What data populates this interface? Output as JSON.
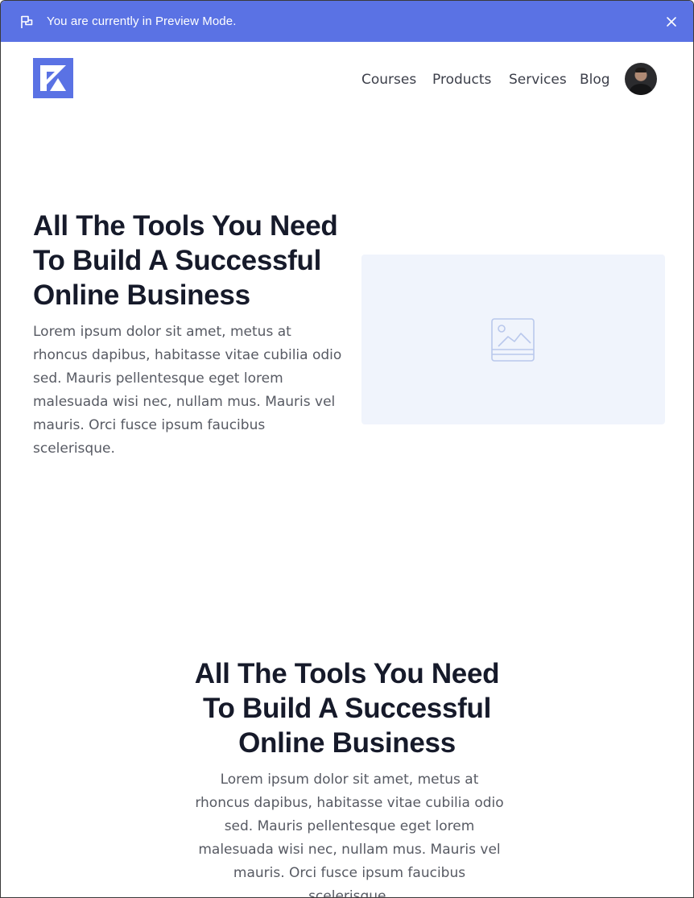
{
  "preview_banner": {
    "text": "You are currently in Preview Mode.",
    "flag_icon": "flag-icon",
    "close_icon": "close-icon",
    "color": "#5a72e4"
  },
  "header": {
    "logo_icon": "kajabi-logo",
    "nav": [
      {
        "label": "Courses"
      },
      {
        "label": "Products"
      },
      {
        "label": "Services"
      },
      {
        "label": "Blog"
      }
    ],
    "avatar": "user-avatar"
  },
  "hero_left": {
    "title": "All The Tools You Need To Build A Successful Online Business",
    "body": "Lorem ipsum dolor sit amet, metus at rhoncus dapibus, habitasse vitae cubilia odio sed. Mauris pellentesque eget lorem malesuada wisi nec, nullam mus. Mauris vel mauris. Orci fusce ipsum faucibus scelerisque.",
    "image_icon": "image-placeholder-icon"
  },
  "hero_centered": {
    "title": "All The Tools You Need To Build A Successful Online Business",
    "body": "Lorem ipsum dolor sit amet, metus at rhoncus dapibus, habitasse vitae cubilia odio sed. Mauris pellentesque eget lorem malesuada wisi nec, nullam mus. Mauris vel mauris. Orci fusce ipsum faucibus scelerisque."
  }
}
